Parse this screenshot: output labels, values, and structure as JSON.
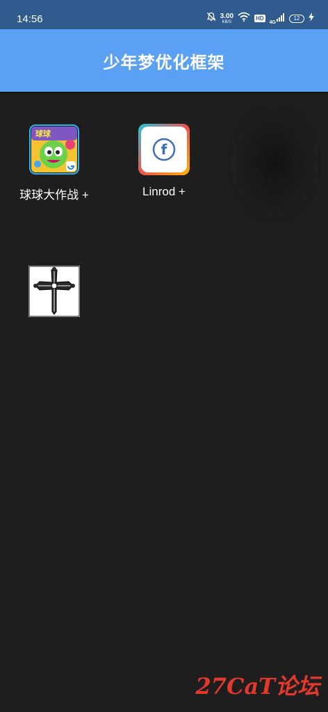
{
  "status_bar": {
    "time": "14:56",
    "net_speed": "3.00",
    "net_speed_unit": "KB/S",
    "hd_badge": "HD",
    "network_type": "4G",
    "battery": "12"
  },
  "header": {
    "title": "少年梦优化框架",
    "color": "#5aa0f4"
  },
  "apps": [
    {
      "label": "球球大作战 +",
      "icon": "battle-of-balls-icon"
    },
    {
      "label": "Linrod +",
      "icon": "facebook-f-icon"
    },
    {
      "label": "",
      "icon": "gothic-cross-icon"
    }
  ],
  "watermark": "27CaT论坛"
}
